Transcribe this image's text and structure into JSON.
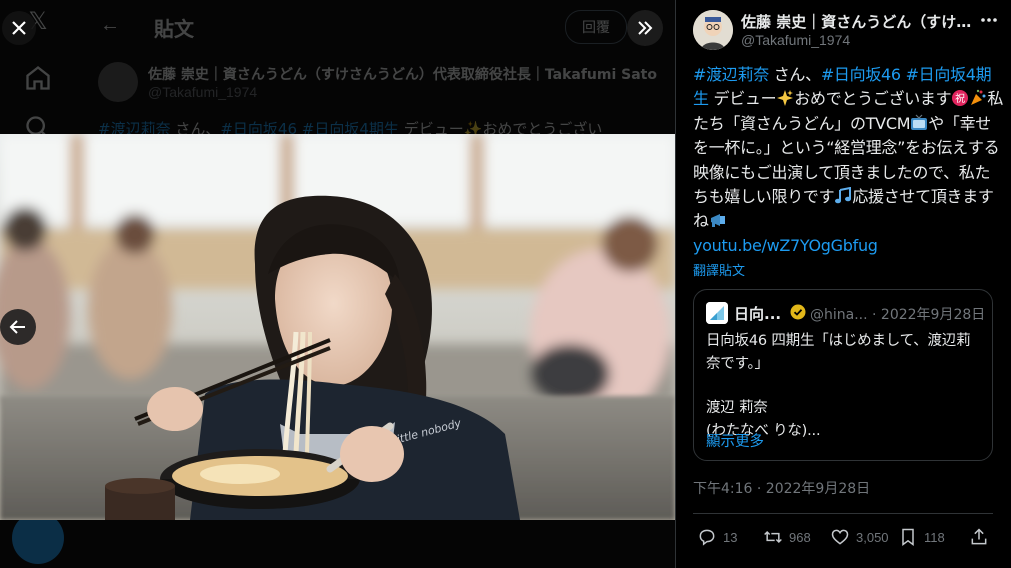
{
  "background": {
    "header_title": "貼文",
    "reply_button": "回覆",
    "author_name": "佐藤 崇史｜資さんうどん（すけさんうどん）代表取締役社長｜Takafumi Sato",
    "author_handle": "@Takafumi_1974",
    "tweet_preview": {
      "hashtag_1": "#渡辺莉奈",
      "text_1": " さん、",
      "hashtag_2": "#日向坂46",
      "hashtag_3": "#日向坂4期生",
      "text_2": " デビュー✨おめでとうござい"
    }
  },
  "viewer": {
    "close_icon": "close-icon",
    "prev_icon": "arrow-left-icon",
    "expand_icon": "double-chevron-right-icon"
  },
  "tweet": {
    "author_name": "佐藤 崇史｜資さんうどん（すけさんうどん）代表取締役社長",
    "author_handle": "@Takafumi_1974",
    "body": {
      "tag_1": "#渡辺莉奈",
      "t_1": " さん、",
      "tag_2": "#日向坂46",
      "tag_3": "#日向坂4期生",
      "t_2": " デビュー",
      "t_3": "おめでとうございます",
      "t_4": "私たち「資さんうどん」のTVCM",
      "t_5": "や「幸せを一杯に。」という“経営理念”をお伝えする映像にもご出演して頂きましたので、私たちも嬉しい限りです",
      "t_6": "応援させて頂きますね",
      "link": "youtu.be/wZ7YOgGbfug"
    },
    "translate_label": "翻譯貼文",
    "quote": {
      "name": "日向...",
      "handle_date": "@hina... · 2022年9月28日",
      "line_1": "日向坂46 四期生「はじめまして、渡辺莉奈です。」",
      "line_2": "渡辺 莉奈",
      "line_3": "(わたなべ りな)...",
      "show_more": "顯示更多"
    },
    "timestamp": "下午4:16 · 2022年9月28日",
    "stats": {
      "replies": "13",
      "reposts": "968",
      "likes": "3,050",
      "bookmarks": "118"
    }
  },
  "colors": {
    "link": "#1d9bf0",
    "text": "#e7e9ea",
    "muted": "#71767b",
    "border": "#2f3336",
    "verified": "#e2b719"
  }
}
